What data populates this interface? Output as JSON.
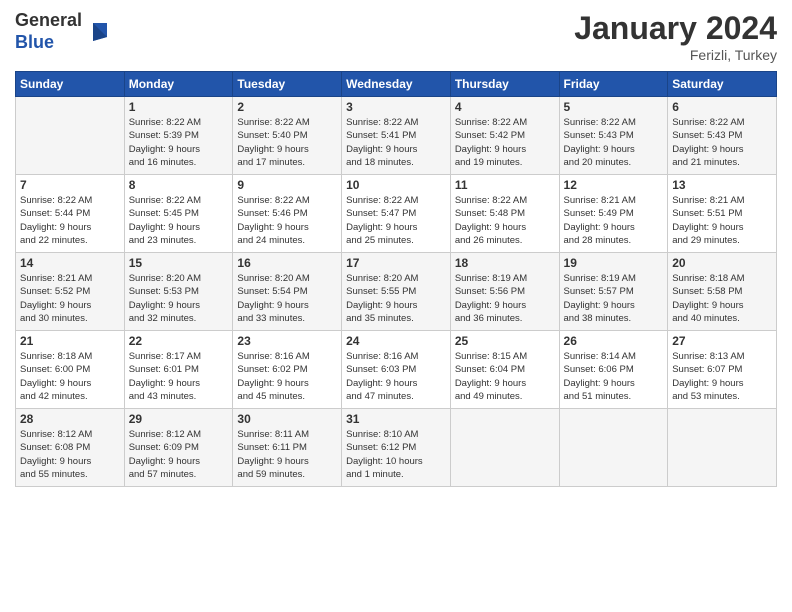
{
  "header": {
    "logo_general": "General",
    "logo_blue": "Blue",
    "month_title": "January 2024",
    "location": "Ferizli, Turkey"
  },
  "days_of_week": [
    "Sunday",
    "Monday",
    "Tuesday",
    "Wednesday",
    "Thursday",
    "Friday",
    "Saturday"
  ],
  "weeks": [
    [
      {
        "day": "",
        "info": ""
      },
      {
        "day": "1",
        "info": "Sunrise: 8:22 AM\nSunset: 5:39 PM\nDaylight: 9 hours\nand 16 minutes."
      },
      {
        "day": "2",
        "info": "Sunrise: 8:22 AM\nSunset: 5:40 PM\nDaylight: 9 hours\nand 17 minutes."
      },
      {
        "day": "3",
        "info": "Sunrise: 8:22 AM\nSunset: 5:41 PM\nDaylight: 9 hours\nand 18 minutes."
      },
      {
        "day": "4",
        "info": "Sunrise: 8:22 AM\nSunset: 5:42 PM\nDaylight: 9 hours\nand 19 minutes."
      },
      {
        "day": "5",
        "info": "Sunrise: 8:22 AM\nSunset: 5:43 PM\nDaylight: 9 hours\nand 20 minutes."
      },
      {
        "day": "6",
        "info": "Sunrise: 8:22 AM\nSunset: 5:43 PM\nDaylight: 9 hours\nand 21 minutes."
      }
    ],
    [
      {
        "day": "7",
        "info": "Sunrise: 8:22 AM\nSunset: 5:44 PM\nDaylight: 9 hours\nand 22 minutes."
      },
      {
        "day": "8",
        "info": "Sunrise: 8:22 AM\nSunset: 5:45 PM\nDaylight: 9 hours\nand 23 minutes."
      },
      {
        "day": "9",
        "info": "Sunrise: 8:22 AM\nSunset: 5:46 PM\nDaylight: 9 hours\nand 24 minutes."
      },
      {
        "day": "10",
        "info": "Sunrise: 8:22 AM\nSunset: 5:47 PM\nDaylight: 9 hours\nand 25 minutes."
      },
      {
        "day": "11",
        "info": "Sunrise: 8:22 AM\nSunset: 5:48 PM\nDaylight: 9 hours\nand 26 minutes."
      },
      {
        "day": "12",
        "info": "Sunrise: 8:21 AM\nSunset: 5:49 PM\nDaylight: 9 hours\nand 28 minutes."
      },
      {
        "day": "13",
        "info": "Sunrise: 8:21 AM\nSunset: 5:51 PM\nDaylight: 9 hours\nand 29 minutes."
      }
    ],
    [
      {
        "day": "14",
        "info": "Sunrise: 8:21 AM\nSunset: 5:52 PM\nDaylight: 9 hours\nand 30 minutes."
      },
      {
        "day": "15",
        "info": "Sunrise: 8:20 AM\nSunset: 5:53 PM\nDaylight: 9 hours\nand 32 minutes."
      },
      {
        "day": "16",
        "info": "Sunrise: 8:20 AM\nSunset: 5:54 PM\nDaylight: 9 hours\nand 33 minutes."
      },
      {
        "day": "17",
        "info": "Sunrise: 8:20 AM\nSunset: 5:55 PM\nDaylight: 9 hours\nand 35 minutes."
      },
      {
        "day": "18",
        "info": "Sunrise: 8:19 AM\nSunset: 5:56 PM\nDaylight: 9 hours\nand 36 minutes."
      },
      {
        "day": "19",
        "info": "Sunrise: 8:19 AM\nSunset: 5:57 PM\nDaylight: 9 hours\nand 38 minutes."
      },
      {
        "day": "20",
        "info": "Sunrise: 8:18 AM\nSunset: 5:58 PM\nDaylight: 9 hours\nand 40 minutes."
      }
    ],
    [
      {
        "day": "21",
        "info": "Sunrise: 8:18 AM\nSunset: 6:00 PM\nDaylight: 9 hours\nand 42 minutes."
      },
      {
        "day": "22",
        "info": "Sunrise: 8:17 AM\nSunset: 6:01 PM\nDaylight: 9 hours\nand 43 minutes."
      },
      {
        "day": "23",
        "info": "Sunrise: 8:16 AM\nSunset: 6:02 PM\nDaylight: 9 hours\nand 45 minutes."
      },
      {
        "day": "24",
        "info": "Sunrise: 8:16 AM\nSunset: 6:03 PM\nDaylight: 9 hours\nand 47 minutes."
      },
      {
        "day": "25",
        "info": "Sunrise: 8:15 AM\nSunset: 6:04 PM\nDaylight: 9 hours\nand 49 minutes."
      },
      {
        "day": "26",
        "info": "Sunrise: 8:14 AM\nSunset: 6:06 PM\nDaylight: 9 hours\nand 51 minutes."
      },
      {
        "day": "27",
        "info": "Sunrise: 8:13 AM\nSunset: 6:07 PM\nDaylight: 9 hours\nand 53 minutes."
      }
    ],
    [
      {
        "day": "28",
        "info": "Sunrise: 8:12 AM\nSunset: 6:08 PM\nDaylight: 9 hours\nand 55 minutes."
      },
      {
        "day": "29",
        "info": "Sunrise: 8:12 AM\nSunset: 6:09 PM\nDaylight: 9 hours\nand 57 minutes."
      },
      {
        "day": "30",
        "info": "Sunrise: 8:11 AM\nSunset: 6:11 PM\nDaylight: 9 hours\nand 59 minutes."
      },
      {
        "day": "31",
        "info": "Sunrise: 8:10 AM\nSunset: 6:12 PM\nDaylight: 10 hours\nand 1 minute."
      },
      {
        "day": "",
        "info": ""
      },
      {
        "day": "",
        "info": ""
      },
      {
        "day": "",
        "info": ""
      }
    ]
  ]
}
